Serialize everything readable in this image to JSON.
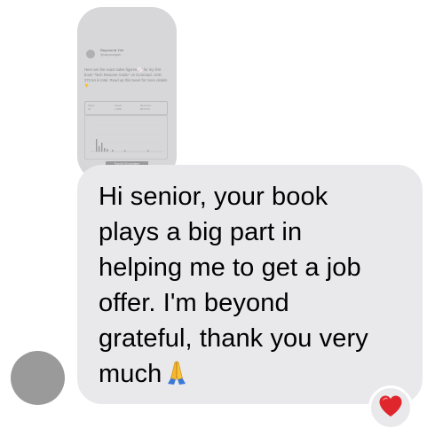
{
  "conversation": {
    "attachment": {
      "author_name": "Raymond Yeh",
      "author_handle": "@raymondyeh",
      "text": "Here are the exact sales figures 📈 for my first book \"Tech Resume Guide\" on Gumroad. USD 372.54 in total. Read up this tweet for more details 👇",
      "stats": [
        {
          "label": "Sales",
          "value": "14"
        },
        {
          "label": "Views",
          "value": "1,089"
        },
        {
          "label": "Revenue",
          "value": "$372.54"
        }
      ],
      "cta": "Pay for 50 numbers"
    },
    "message": {
      "lines": [
        "Hi senior, your book",
        "plays a big part in",
        "helping me to get a job",
        "offer. I'm beyond",
        "grateful, thank you very",
        "much"
      ],
      "emoji": "folded-hands"
    },
    "reaction": {
      "icon": "heart-icon",
      "color": "#e0262d"
    },
    "colors": {
      "bubble_received": "#e9e9eb",
      "avatar_placeholder": "#9a9a9a"
    }
  }
}
